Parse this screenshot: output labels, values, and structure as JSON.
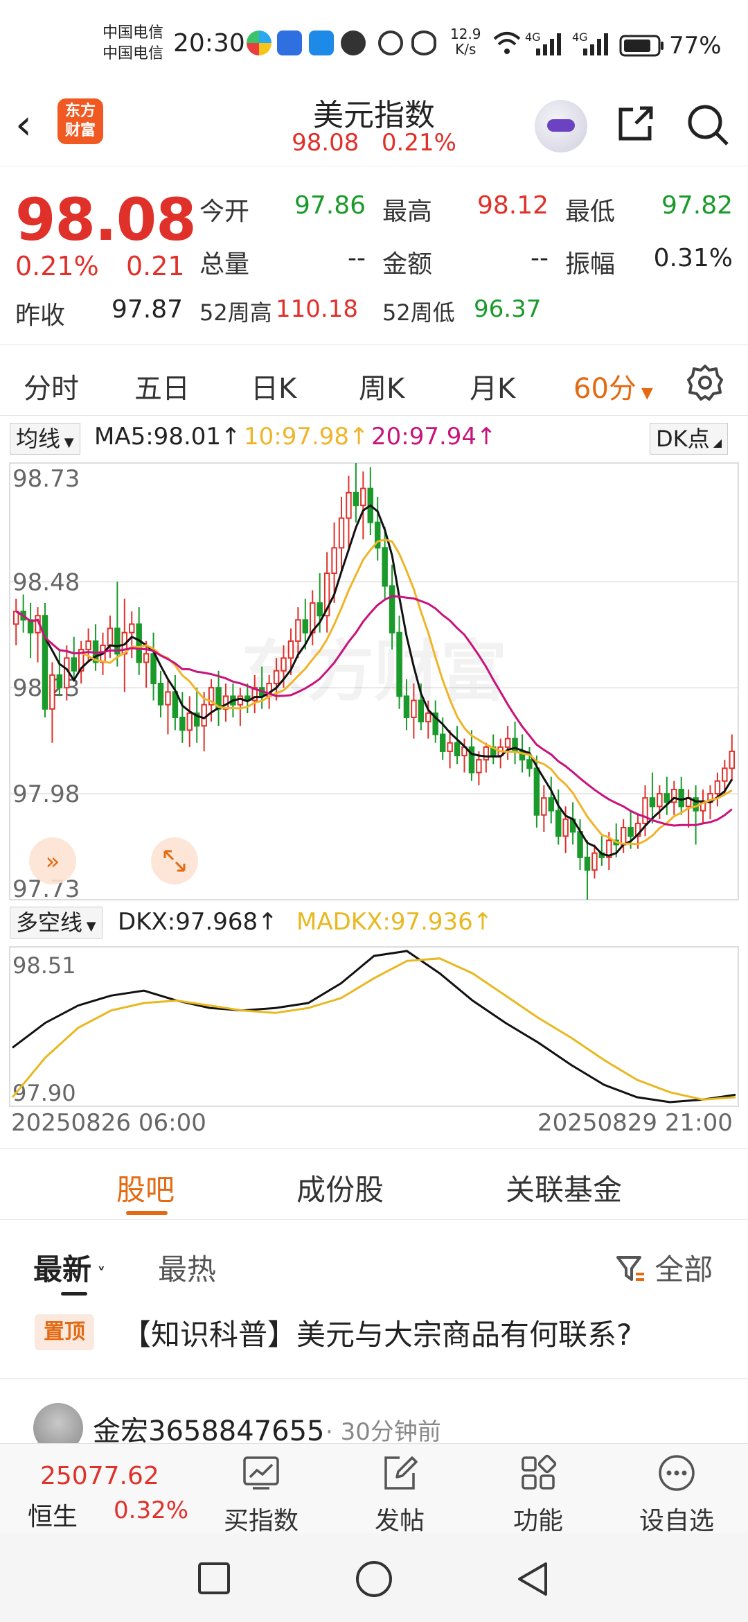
{
  "status_bar": {
    "carrier1": "中国电信",
    "carrier2": "中国电信",
    "time": "20:30",
    "net_speed_value": "12.9",
    "net_speed_unit": "K/s",
    "signal1": "4G",
    "signal2": "4G",
    "battery": "77%"
  },
  "header": {
    "logo_line1": "东方",
    "logo_line2": "财富",
    "title": "美元指数",
    "price": "98.08",
    "change_pct": "0.21%"
  },
  "quote": {
    "price": "98.08",
    "change_pct": "0.21%",
    "change": "0.21",
    "prev_close_label": "昨收",
    "prev_close": "97.87",
    "open_label": "今开",
    "open": "97.86",
    "high_label": "最高",
    "high": "98.12",
    "low_label": "最低",
    "low": "97.82",
    "volume_label": "总量",
    "volume": "--",
    "amount_label": "金额",
    "amount": "--",
    "amplitude_label": "振幅",
    "amplitude": "0.31%",
    "wk52_high_label": "52周高",
    "wk52_high": "110.18",
    "wk52_low_label": "52周低",
    "wk52_low": "96.37"
  },
  "period_tabs": [
    "分时",
    "五日",
    "日K",
    "周K",
    "月K",
    "60分"
  ],
  "chart_panel": {
    "indicator_select": "均线",
    "ma5": "MA5:98.01↑",
    "ma10": "10:97.98↑",
    "ma20": "20:97.94↑",
    "dk_button": "DK点",
    "sub_indicator_select": "多空线",
    "dkx": "DKX:97.968↑",
    "madkx": "MADKX:97.936↑",
    "start_time": "20250826 06:00",
    "end_time": "20250829 21:00",
    "watermark": "东方财富"
  },
  "chart_data": [
    {
      "type": "candlestick",
      "title": "",
      "y_ticks": [
        "98.73",
        "98.48",
        "98.23",
        "97.98",
        "97.73"
      ],
      "ylim": [
        97.73,
        98.76
      ],
      "grid": true,
      "colors": {
        "up": "#e0302a",
        "down": "#1a9a2a",
        "ma5": "#111111",
        "ma10": "#f0b429",
        "ma20": "#c8137c"
      },
      "candles": [
        {
          "o": 98.38,
          "h": 98.44,
          "l": 98.33,
          "c": 98.41
        },
        {
          "o": 98.41,
          "h": 98.45,
          "l": 98.36,
          "c": 98.39
        },
        {
          "o": 98.39,
          "h": 98.43,
          "l": 98.3,
          "c": 98.36
        },
        {
          "o": 98.36,
          "h": 98.42,
          "l": 98.29,
          "c": 98.4
        },
        {
          "o": 98.4,
          "h": 98.43,
          "l": 98.16,
          "c": 98.18
        },
        {
          "o": 98.18,
          "h": 98.29,
          "l": 98.1,
          "c": 98.26
        },
        {
          "o": 98.26,
          "h": 98.32,
          "l": 98.21,
          "c": 98.23
        },
        {
          "o": 98.23,
          "h": 98.33,
          "l": 98.2,
          "c": 98.3
        },
        {
          "o": 98.3,
          "h": 98.35,
          "l": 98.25,
          "c": 98.27
        },
        {
          "o": 98.27,
          "h": 98.34,
          "l": 98.24,
          "c": 98.32
        },
        {
          "o": 98.32,
          "h": 98.37,
          "l": 98.29,
          "c": 98.34
        },
        {
          "o": 98.34,
          "h": 98.38,
          "l": 98.27,
          "c": 98.29
        },
        {
          "o": 98.29,
          "h": 98.36,
          "l": 98.26,
          "c": 98.33
        },
        {
          "o": 98.33,
          "h": 98.4,
          "l": 98.3,
          "c": 98.37
        },
        {
          "o": 98.37,
          "h": 98.48,
          "l": 98.28,
          "c": 98.31
        },
        {
          "o": 98.31,
          "h": 98.44,
          "l": 98.22,
          "c": 98.36
        },
        {
          "o": 98.36,
          "h": 98.41,
          "l": 98.3,
          "c": 98.38
        },
        {
          "o": 98.38,
          "h": 98.42,
          "l": 98.26,
          "c": 98.29
        },
        {
          "o": 98.29,
          "h": 98.34,
          "l": 98.23,
          "c": 98.31
        },
        {
          "o": 98.31,
          "h": 98.36,
          "l": 98.2,
          "c": 98.24
        },
        {
          "o": 98.24,
          "h": 98.27,
          "l": 98.16,
          "c": 98.19
        },
        {
          "o": 98.19,
          "h": 98.25,
          "l": 98.12,
          "c": 98.22
        },
        {
          "o": 98.22,
          "h": 98.26,
          "l": 98.13,
          "c": 98.16
        },
        {
          "o": 98.16,
          "h": 98.22,
          "l": 98.1,
          "c": 98.13
        },
        {
          "o": 98.13,
          "h": 98.21,
          "l": 98.09,
          "c": 98.17
        },
        {
          "o": 98.17,
          "h": 98.23,
          "l": 98.1,
          "c": 98.14
        },
        {
          "o": 98.14,
          "h": 98.22,
          "l": 98.08,
          "c": 98.19
        },
        {
          "o": 98.19,
          "h": 98.25,
          "l": 98.15,
          "c": 98.23
        },
        {
          "o": 98.23,
          "h": 98.27,
          "l": 98.14,
          "c": 98.18
        },
        {
          "o": 98.18,
          "h": 98.24,
          "l": 98.15,
          "c": 98.21
        },
        {
          "o": 98.21,
          "h": 98.24,
          "l": 98.16,
          "c": 98.19
        },
        {
          "o": 98.19,
          "h": 98.23,
          "l": 98.14,
          "c": 98.21
        },
        {
          "o": 98.21,
          "h": 98.24,
          "l": 98.17,
          "c": 98.2
        },
        {
          "o": 98.2,
          "h": 98.26,
          "l": 98.17,
          "c": 98.23
        },
        {
          "o": 98.23,
          "h": 98.28,
          "l": 98.18,
          "c": 98.21
        },
        {
          "o": 98.21,
          "h": 98.26,
          "l": 98.18,
          "c": 98.24
        },
        {
          "o": 98.24,
          "h": 98.3,
          "l": 98.2,
          "c": 98.27
        },
        {
          "o": 98.27,
          "h": 98.33,
          "l": 98.23,
          "c": 98.3
        },
        {
          "o": 98.3,
          "h": 98.37,
          "l": 98.26,
          "c": 98.34
        },
        {
          "o": 98.34,
          "h": 98.42,
          "l": 98.3,
          "c": 98.39
        },
        {
          "o": 98.39,
          "h": 98.44,
          "l": 98.32,
          "c": 98.36
        },
        {
          "o": 98.36,
          "h": 98.46,
          "l": 98.33,
          "c": 98.43
        },
        {
          "o": 98.43,
          "h": 98.5,
          "l": 98.36,
          "c": 98.4
        },
        {
          "o": 98.4,
          "h": 98.55,
          "l": 98.36,
          "c": 98.5
        },
        {
          "o": 98.5,
          "h": 98.62,
          "l": 98.43,
          "c": 98.56
        },
        {
          "o": 98.56,
          "h": 98.68,
          "l": 98.5,
          "c": 98.63
        },
        {
          "o": 98.63,
          "h": 98.73,
          "l": 98.56,
          "c": 98.69
        },
        {
          "o": 98.69,
          "h": 98.76,
          "l": 98.62,
          "c": 98.66
        },
        {
          "o": 98.66,
          "h": 98.74,
          "l": 98.58,
          "c": 98.7
        },
        {
          "o": 98.7,
          "h": 98.75,
          "l": 98.59,
          "c": 98.62
        },
        {
          "o": 98.62,
          "h": 98.68,
          "l": 98.53,
          "c": 98.56
        },
        {
          "o": 98.56,
          "h": 98.61,
          "l": 98.44,
          "c": 98.47
        },
        {
          "o": 98.47,
          "h": 98.52,
          "l": 98.32,
          "c": 98.36
        },
        {
          "o": 98.36,
          "h": 98.4,
          "l": 98.18,
          "c": 98.21
        },
        {
          "o": 98.21,
          "h": 98.25,
          "l": 98.13,
          "c": 98.16
        },
        {
          "o": 98.16,
          "h": 98.24,
          "l": 98.11,
          "c": 98.2
        },
        {
          "o": 98.2,
          "h": 98.24,
          "l": 98.13,
          "c": 98.15
        },
        {
          "o": 98.15,
          "h": 98.2,
          "l": 98.11,
          "c": 98.17
        },
        {
          "o": 98.17,
          "h": 98.2,
          "l": 98.1,
          "c": 98.12
        },
        {
          "o": 98.12,
          "h": 98.16,
          "l": 98.06,
          "c": 98.08
        },
        {
          "o": 98.08,
          "h": 98.13,
          "l": 98.04,
          "c": 98.1
        },
        {
          "o": 98.1,
          "h": 98.14,
          "l": 98.05,
          "c": 98.07
        },
        {
          "o": 98.07,
          "h": 98.11,
          "l": 98.03,
          "c": 98.09
        },
        {
          "o": 98.09,
          "h": 98.13,
          "l": 98.01,
          "c": 98.03
        },
        {
          "o": 98.03,
          "h": 98.08,
          "l": 98.0,
          "c": 98.06
        },
        {
          "o": 98.06,
          "h": 98.1,
          "l": 98.03,
          "c": 98.09
        },
        {
          "o": 98.09,
          "h": 98.12,
          "l": 98.05,
          "c": 98.07
        },
        {
          "o": 98.07,
          "h": 98.11,
          "l": 98.04,
          "c": 98.09
        },
        {
          "o": 98.09,
          "h": 98.14,
          "l": 98.06,
          "c": 98.11
        },
        {
          "o": 98.11,
          "h": 98.15,
          "l": 98.05,
          "c": 98.08
        },
        {
          "o": 98.08,
          "h": 98.12,
          "l": 98.03,
          "c": 98.06
        },
        {
          "o": 98.06,
          "h": 98.09,
          "l": 98.02,
          "c": 98.04
        },
        {
          "o": 98.04,
          "h": 98.07,
          "l": 97.9,
          "c": 97.93
        },
        {
          "o": 97.93,
          "h": 98.0,
          "l": 97.89,
          "c": 97.97
        },
        {
          "o": 97.97,
          "h": 98.02,
          "l": 97.91,
          "c": 97.94
        },
        {
          "o": 97.94,
          "h": 97.99,
          "l": 97.86,
          "c": 97.88
        },
        {
          "o": 97.88,
          "h": 97.95,
          "l": 97.84,
          "c": 97.92
        },
        {
          "o": 97.92,
          "h": 97.96,
          "l": 97.86,
          "c": 97.89
        },
        {
          "o": 97.89,
          "h": 97.92,
          "l": 97.8,
          "c": 97.83
        },
        {
          "o": 97.83,
          "h": 97.87,
          "l": 97.73,
          "c": 97.8
        },
        {
          "o": 97.8,
          "h": 97.86,
          "l": 97.78,
          "c": 97.84
        },
        {
          "o": 97.84,
          "h": 97.88,
          "l": 97.81,
          "c": 97.83
        },
        {
          "o": 97.83,
          "h": 97.89,
          "l": 97.8,
          "c": 97.87
        },
        {
          "o": 97.87,
          "h": 97.91,
          "l": 97.83,
          "c": 97.86
        },
        {
          "o": 97.86,
          "h": 97.92,
          "l": 97.84,
          "c": 97.9
        },
        {
          "o": 97.9,
          "h": 97.94,
          "l": 97.85,
          "c": 97.88
        },
        {
          "o": 97.88,
          "h": 97.93,
          "l": 97.85,
          "c": 97.91
        },
        {
          "o": 97.91,
          "h": 98.0,
          "l": 97.88,
          "c": 97.97
        },
        {
          "o": 97.97,
          "h": 98.03,
          "l": 97.91,
          "c": 97.95
        },
        {
          "o": 97.95,
          "h": 98.0,
          "l": 97.92,
          "c": 97.98
        },
        {
          "o": 97.98,
          "h": 98.02,
          "l": 97.93,
          "c": 97.96
        },
        {
          "o": 97.96,
          "h": 98.01,
          "l": 97.93,
          "c": 97.99
        },
        {
          "o": 97.99,
          "h": 98.02,
          "l": 97.93,
          "c": 97.95
        },
        {
          "o": 97.95,
          "h": 97.99,
          "l": 97.9,
          "c": 97.97
        },
        {
          "o": 97.97,
          "h": 98.0,
          "l": 97.86,
          "c": 97.94
        },
        {
          "o": 97.94,
          "h": 97.99,
          "l": 97.91,
          "c": 97.96
        },
        {
          "o": 97.96,
          "h": 98.0,
          "l": 97.92,
          "c": 97.98
        },
        {
          "o": 97.98,
          "h": 98.03,
          "l": 97.95,
          "c": 98.01
        },
        {
          "o": 98.01,
          "h": 98.06,
          "l": 97.98,
          "c": 98.04
        },
        {
          "o": 98.04,
          "h": 98.12,
          "l": 98.01,
          "c": 98.08
        }
      ]
    },
    {
      "type": "line",
      "title": "",
      "y_ticks": [
        "98.51",
        "97.90"
      ],
      "ylim": [
        97.9,
        98.51
      ],
      "grid": false,
      "x": [
        "20250826 06:00",
        "20250829 21:00"
      ],
      "series": [
        {
          "name": "DKX",
          "color": "#111111",
          "values": [
            98.12,
            98.22,
            98.29,
            98.33,
            98.35,
            98.31,
            98.28,
            98.27,
            98.28,
            98.3,
            98.38,
            98.49,
            98.51,
            98.42,
            98.31,
            98.22,
            98.14,
            98.05,
            97.97,
            97.92,
            97.9,
            97.91,
            97.93
          ]
        },
        {
          "name": "MADKX",
          "color": "#e8b820",
          "values": [
            97.92,
            98.08,
            98.2,
            98.27,
            98.3,
            98.31,
            98.29,
            98.27,
            98.26,
            98.28,
            98.32,
            98.4,
            98.47,
            98.48,
            98.42,
            98.33,
            98.24,
            98.16,
            98.07,
            97.99,
            97.94,
            97.91,
            97.92
          ]
        }
      ]
    }
  ],
  "sub_tabs": [
    "股吧",
    "成份股",
    "关联基金"
  ],
  "feed": {
    "filter_latest": "最新",
    "filter_hot": "最热",
    "filter_all": "全部",
    "pin_tag": "置顶",
    "pin_title": "【知识科普】美元与大宗商品有何联系?",
    "user": "金宏3658847655",
    "time": "30分钟前"
  },
  "bottom_nav": {
    "index_value": "25077.62",
    "index_name": "恒生",
    "index_change": "0.32%",
    "buy_index": "买指数",
    "post": "发帖",
    "functions": "功能",
    "add_watch": "设自选"
  }
}
